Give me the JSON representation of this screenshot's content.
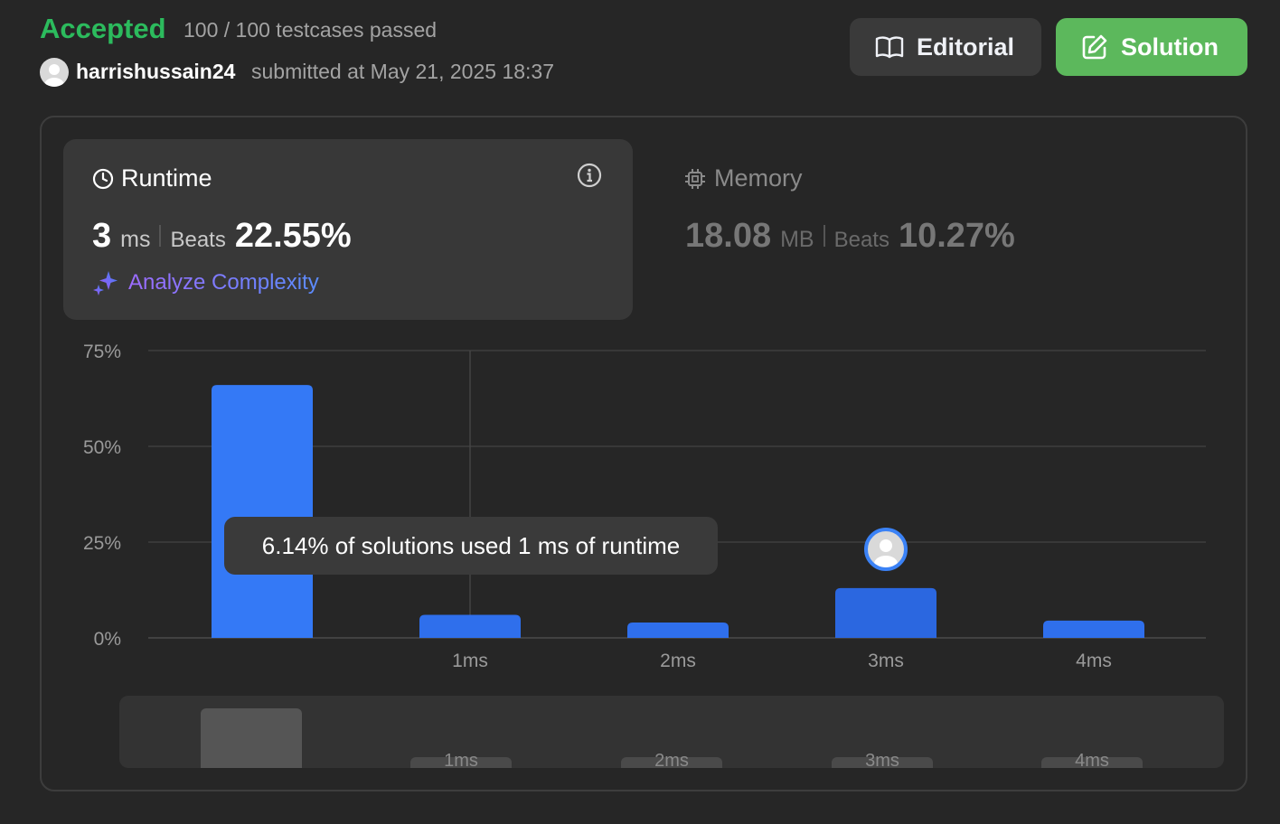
{
  "status": {
    "label": "Accepted",
    "testcases": "100 / 100 testcases passed",
    "username": "harrishussain24",
    "submitted": "submitted at May 21, 2025 18:37"
  },
  "buttons": {
    "editorial": "Editorial",
    "solution": "Solution"
  },
  "runtime": {
    "title": "Runtime",
    "value": "3",
    "unit": "ms",
    "beats_label": "Beats",
    "beats_value": "22.55%",
    "analyze": "Analyze Complexity"
  },
  "memory": {
    "title": "Memory",
    "value": "18.08",
    "unit": "MB",
    "beats_label": "Beats",
    "beats_value": "10.27%"
  },
  "tooltip": {
    "text": "6.14% of solutions used 1 ms of runtime"
  },
  "colors": {
    "accepted": "#2cbb5d",
    "bar": "#2f6fec",
    "bar_selected": "#3479f6",
    "solution_button": "#5cb85c"
  },
  "chart_data": {
    "type": "bar",
    "categories": [
      "",
      "1ms",
      "2ms",
      "3ms",
      "4ms"
    ],
    "values": [
      66,
      6,
      4,
      13,
      4.5
    ],
    "ylim": [
      0,
      75
    ],
    "yticks": [
      "0%",
      "25%",
      "50%",
      "75%"
    ],
    "ytick_values": [
      0,
      25,
      50,
      75
    ],
    "highlighted_category": "3ms",
    "hover_category": "1ms",
    "grid": true
  },
  "mini_chart": {
    "categories": [
      "",
      "1ms",
      "2ms",
      "3ms",
      "4ms"
    ],
    "values": [
      66,
      6,
      4,
      13,
      4.5
    ]
  }
}
